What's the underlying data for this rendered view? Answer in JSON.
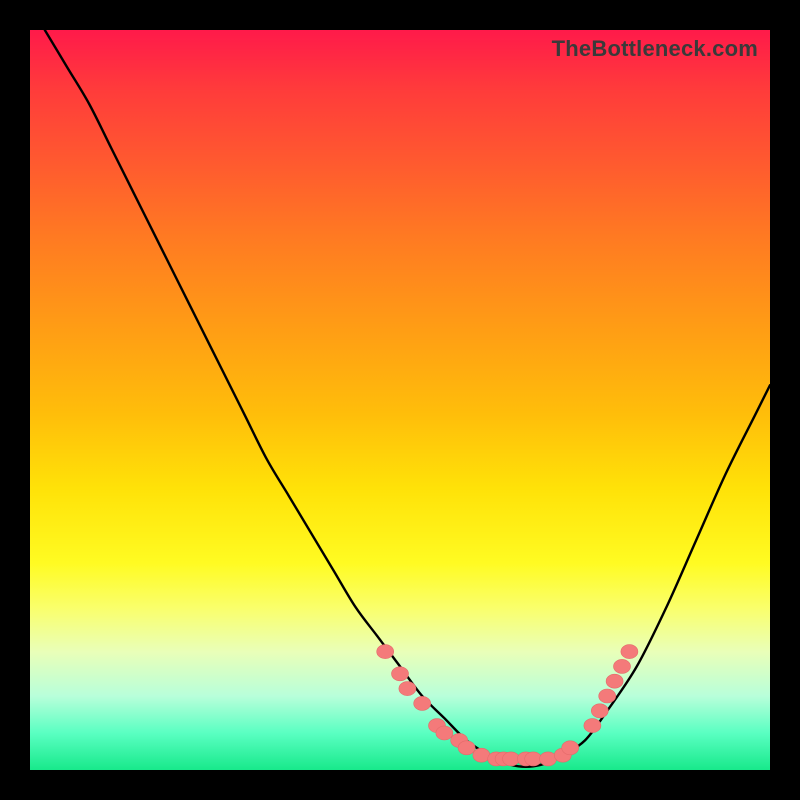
{
  "attribution": "TheBottleneck.com",
  "colors": {
    "curve_stroke": "#000000",
    "marker_fill": "#f47a7a",
    "marker_stroke": "#e46a6a"
  },
  "chart_data": {
    "type": "line",
    "title": "",
    "xlabel": "",
    "ylabel": "",
    "xlim": [
      0,
      100
    ],
    "ylim": [
      0,
      100
    ],
    "grid": false,
    "series": [
      {
        "name": "bottleneck-curve",
        "x": [
          2,
          5,
          8,
          11,
          14,
          17,
          20,
          23,
          26,
          29,
          32,
          35,
          38,
          41,
          44,
          47,
          50,
          53,
          56,
          59,
          62,
          64,
          66,
          68,
          70,
          72,
          75,
          78,
          82,
          86,
          90,
          94,
          98,
          100
        ],
        "y": [
          100,
          95,
          90,
          84,
          78,
          72,
          66,
          60,
          54,
          48,
          42,
          37,
          32,
          27,
          22,
          18,
          14,
          10,
          7,
          4,
          2,
          1,
          0.5,
          0.5,
          1,
          2,
          4,
          8,
          14,
          22,
          31,
          40,
          48,
          52
        ]
      }
    ],
    "markers": {
      "name": "sweet-spot-markers",
      "points": [
        {
          "x": 48,
          "y": 16
        },
        {
          "x": 50,
          "y": 13
        },
        {
          "x": 51,
          "y": 11
        },
        {
          "x": 53,
          "y": 9
        },
        {
          "x": 55,
          "y": 6
        },
        {
          "x": 56,
          "y": 5
        },
        {
          "x": 58,
          "y": 4
        },
        {
          "x": 59,
          "y": 3
        },
        {
          "x": 61,
          "y": 2
        },
        {
          "x": 63,
          "y": 1.5
        },
        {
          "x": 64,
          "y": 1.5
        },
        {
          "x": 65,
          "y": 1.5
        },
        {
          "x": 67,
          "y": 1.5
        },
        {
          "x": 68,
          "y": 1.5
        },
        {
          "x": 70,
          "y": 1.5
        },
        {
          "x": 72,
          "y": 2
        },
        {
          "x": 73,
          "y": 3
        },
        {
          "x": 76,
          "y": 6
        },
        {
          "x": 77,
          "y": 8
        },
        {
          "x": 78,
          "y": 10
        },
        {
          "x": 79,
          "y": 12
        },
        {
          "x": 80,
          "y": 14
        },
        {
          "x": 81,
          "y": 16
        }
      ]
    }
  }
}
